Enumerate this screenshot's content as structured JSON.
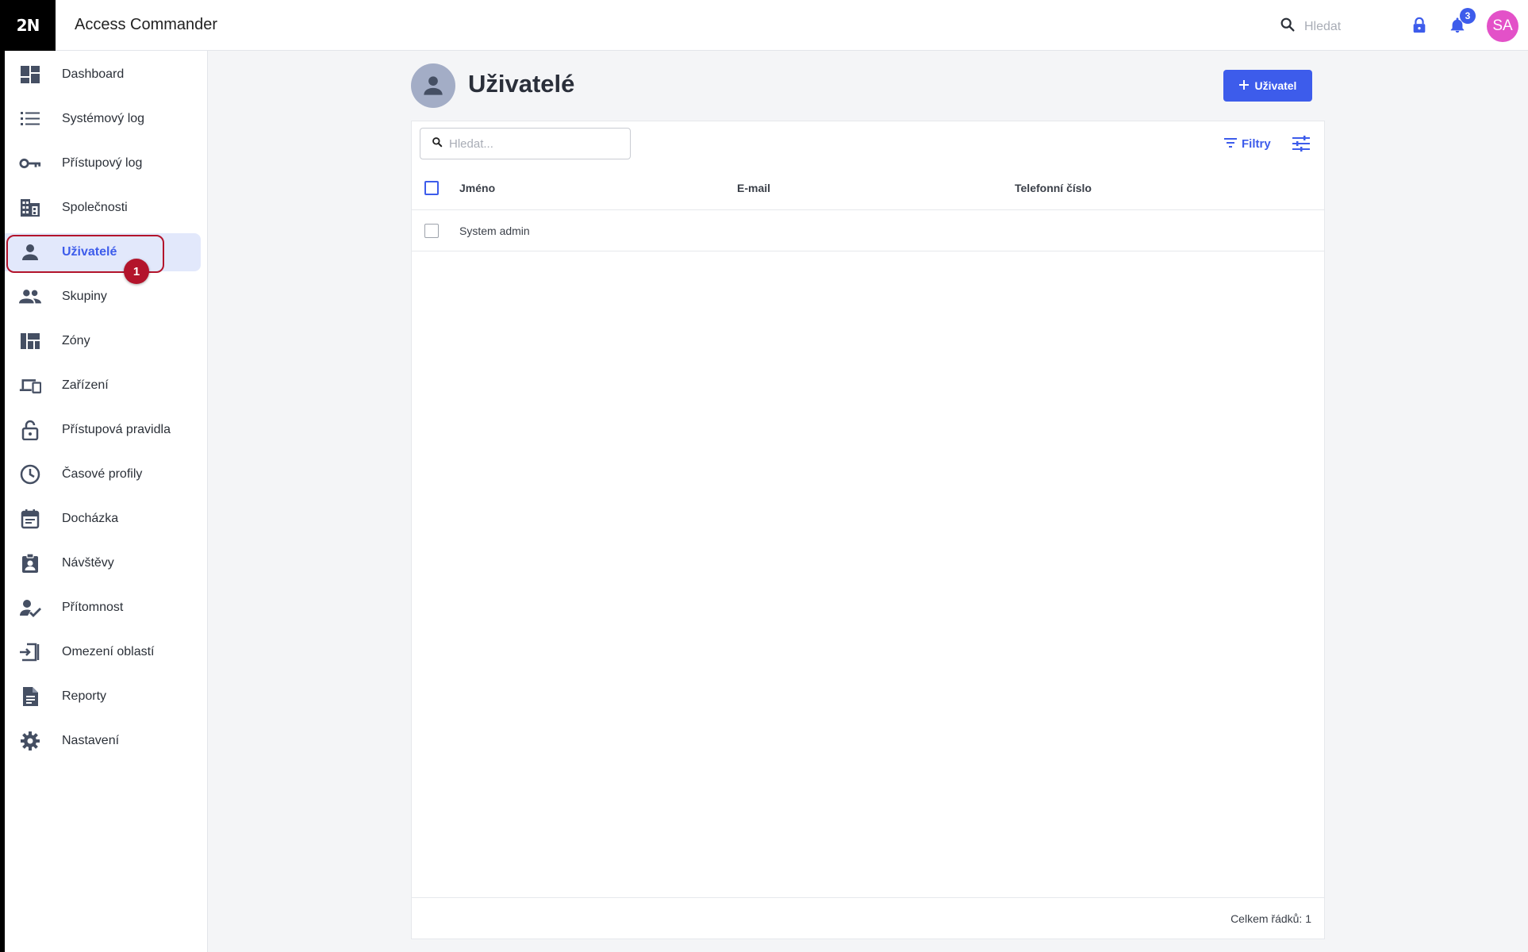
{
  "app": {
    "logo_text": "2N",
    "title": "Access Commander"
  },
  "topbar": {
    "search_placeholder": "Hledat",
    "notification_count": "3",
    "user_initials": "SA"
  },
  "sidebar": {
    "items": [
      {
        "label": "Dashboard",
        "icon": "dashboard-icon"
      },
      {
        "label": "Systémový log",
        "icon": "list-icon"
      },
      {
        "label": "Přístupový log",
        "icon": "key-icon"
      },
      {
        "label": "Společnosti",
        "icon": "building-icon"
      },
      {
        "label": "Uživatelé",
        "icon": "user-icon",
        "active": true
      },
      {
        "label": "Skupiny",
        "icon": "group-icon"
      },
      {
        "label": "Zóny",
        "icon": "zones-icon"
      },
      {
        "label": "Zařízení",
        "icon": "devices-icon"
      },
      {
        "label": "Přístupová pravidla",
        "icon": "lock-open-icon"
      },
      {
        "label": "Časové profily",
        "icon": "clock-icon"
      },
      {
        "label": "Docházka",
        "icon": "calendar-icon"
      },
      {
        "label": "Návštěvy",
        "icon": "visitor-badge-icon"
      },
      {
        "label": "Přítomnost",
        "icon": "user-check-icon"
      },
      {
        "label": "Omezení oblastí",
        "icon": "area-limit-icon"
      },
      {
        "label": "Reporty",
        "icon": "report-icon"
      },
      {
        "label": "Nastavení",
        "icon": "gear-icon"
      }
    ],
    "step_marker": "1"
  },
  "page": {
    "title": "Uživatelé",
    "add_button_label": "Uživatel"
  },
  "table": {
    "search_placeholder": "Hledat...",
    "filters_label": "Filtry",
    "columns": [
      "Jméno",
      "E-mail",
      "Telefonní číslo"
    ],
    "rows": [
      {
        "name": "System admin",
        "email": "",
        "phone": ""
      }
    ],
    "total_label": "Celkem řádků: 1"
  },
  "colors": {
    "accent": "#3d5ceb",
    "active_bg": "#e2e8fb",
    "step_marker": "#b3142b",
    "avatar": "#e351c8"
  }
}
